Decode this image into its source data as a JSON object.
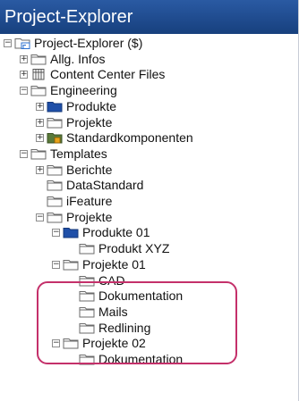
{
  "panel": {
    "title": "Project-Explorer"
  },
  "tree": {
    "nodes": [
      {
        "label": "Project-Explorer ($)",
        "icon": "project-root-icon",
        "expander": "minus",
        "depth": 0
      },
      {
        "label": "Allg. Infos",
        "icon": "folder-icon",
        "expander": "plus",
        "depth": 1
      },
      {
        "label": "Content Center Files",
        "icon": "content-center-icon",
        "expander": "plus",
        "depth": 1
      },
      {
        "label": "Engineering",
        "icon": "folder-icon",
        "expander": "minus",
        "depth": 1
      },
      {
        "label": "Produkte",
        "icon": "folder-blue-icon",
        "expander": "plus",
        "depth": 2
      },
      {
        "label": "Projekte",
        "icon": "folder-icon",
        "expander": "plus",
        "depth": 2
      },
      {
        "label": "Standardkomponenten",
        "icon": "folder-locked-icon",
        "expander": "plus",
        "depth": 2
      },
      {
        "label": "Templates",
        "icon": "folder-icon",
        "expander": "minus",
        "depth": 1
      },
      {
        "label": "Berichte",
        "icon": "folder-icon",
        "expander": "plus",
        "depth": 2
      },
      {
        "label": "DataStandard",
        "icon": "folder-icon",
        "expander": "none",
        "depth": 2
      },
      {
        "label": "iFeature",
        "icon": "folder-icon",
        "expander": "none",
        "depth": 2
      },
      {
        "label": "Projekte",
        "icon": "folder-icon",
        "expander": "minus",
        "depth": 2
      },
      {
        "label": "Produkte 01",
        "icon": "folder-blue-icon",
        "expander": "minus",
        "depth": 3
      },
      {
        "label": "Produkt XYZ",
        "icon": "folder-icon",
        "expander": "none",
        "depth": 4
      },
      {
        "label": "Projekte 01",
        "icon": "folder-icon",
        "expander": "minus",
        "depth": 3
      },
      {
        "label": "CAD",
        "icon": "folder-icon",
        "expander": "none",
        "depth": 4
      },
      {
        "label": "Dokumentation",
        "icon": "folder-icon",
        "expander": "none",
        "depth": 4
      },
      {
        "label": "Mails",
        "icon": "folder-icon",
        "expander": "none",
        "depth": 4
      },
      {
        "label": "Redlining",
        "icon": "folder-icon",
        "expander": "none",
        "depth": 4
      },
      {
        "label": "Projekte 02",
        "icon": "folder-icon",
        "expander": "minus",
        "depth": 3
      },
      {
        "label": "Dokumentation",
        "icon": "folder-icon",
        "expander": "none",
        "depth": 4
      }
    ]
  },
  "colors": {
    "titlebar": "#1e4a8f",
    "highlight": "#c4306a",
    "folder_fill": "#fdfdfd",
    "folder_blue": "#1f4fa8"
  }
}
